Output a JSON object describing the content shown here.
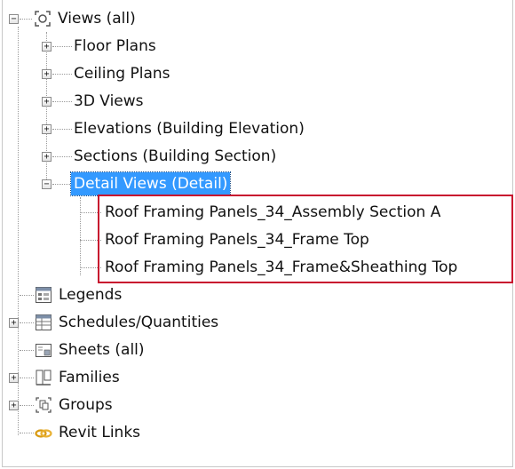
{
  "tree": {
    "root": "Views (all)",
    "children": [
      "Floor Plans",
      "Ceiling Plans",
      "3D Views",
      "Elevations (Building Elevation)",
      "Sections (Building Section)"
    ],
    "selected": "Detail Views (Detail)",
    "detail_items": [
      "Roof Framing Panels_34_Assembly Section A",
      "Roof Framing Panels_34_Frame Top",
      "Roof Framing Panels_34_Frame&Sheathing Top"
    ],
    "others": [
      "Legends",
      "Schedules/Quantities",
      "Sheets (all)",
      "Families",
      "Groups",
      "Revit Links"
    ]
  },
  "colors": {
    "selection": "#3399ff",
    "highlight_box": "#c8102e"
  },
  "icons": [
    "views-icon",
    "legends-icon",
    "schedules-icon",
    "sheets-icon",
    "families-icon",
    "groups-icon",
    "revit-links-icon"
  ]
}
